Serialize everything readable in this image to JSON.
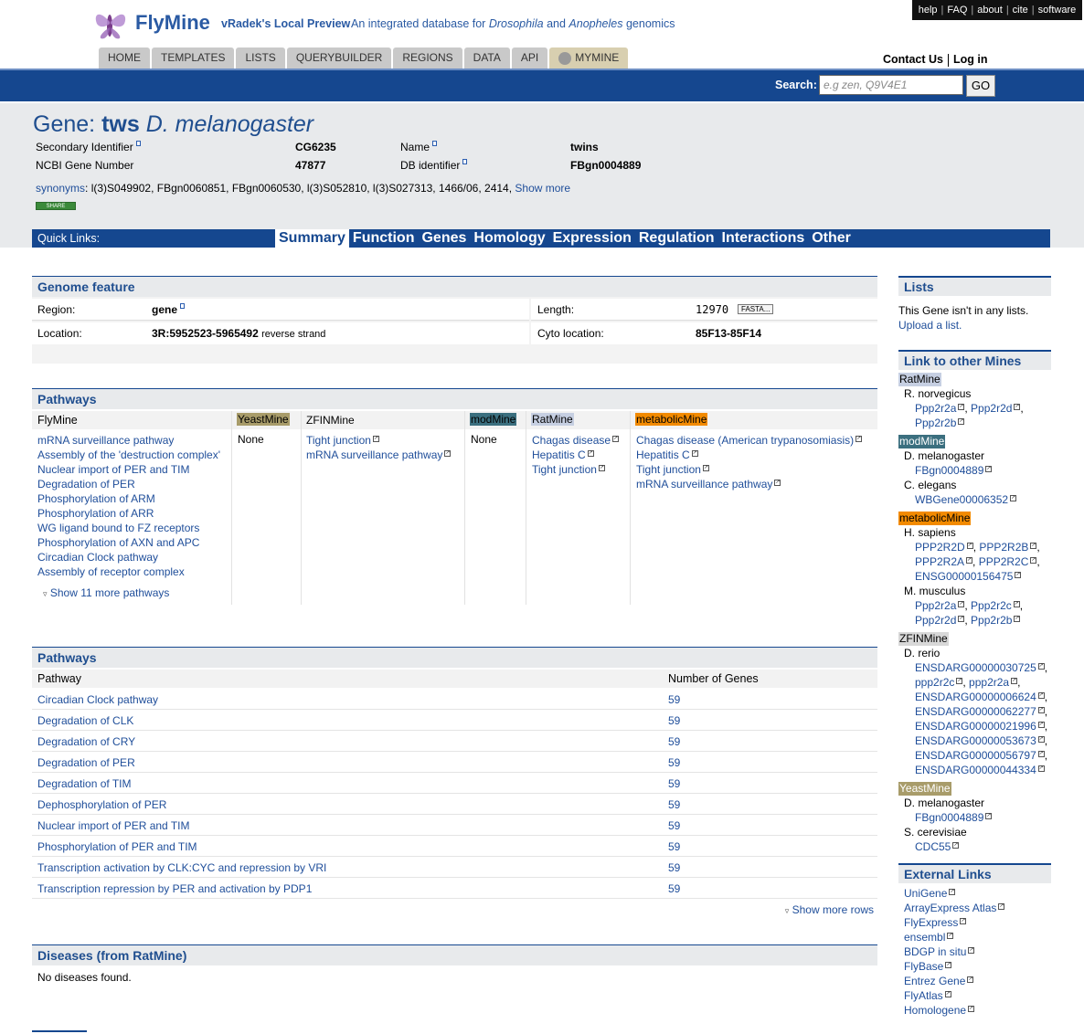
{
  "header": {
    "brand": "FlyMine",
    "preview": "vRadek's Local Preview",
    "tagline_pre": "An integrated database for",
    "tagline_dros": "Drosophila",
    "tagline_and": "and",
    "tagline_anoph": "Anopheles",
    "tagline_post": "genomics",
    "toplinks": [
      "help",
      "FAQ",
      "about",
      "cite",
      "software"
    ],
    "tabs": [
      "HOME",
      "TEMPLATES",
      "LISTS",
      "QUERYBUILDER",
      "REGIONS",
      "DATA",
      "API",
      "MYMINE"
    ],
    "contact": "Contact Us",
    "login": "Log in",
    "search_label": "Search:",
    "search_placeholder": "e.g zen, Q9V4E1",
    "go": "GO"
  },
  "gene": {
    "title_prefix": "Gene:",
    "symbol": "tws",
    "organism": "D. melanogaster",
    "fields": [
      {
        "label": "Secondary Identifier",
        "value": "CG6235"
      },
      {
        "label": "NCBI Gene Number",
        "value": "47877"
      },
      {
        "label": "Name",
        "value": "twins"
      },
      {
        "label": "DB identifier",
        "value": "FBgn0004889"
      }
    ],
    "synonyms_label": "synonyms",
    "synonyms": ": l(3)S049902, FBgn0060851, FBgn0060530, l(3)S052810, l(3)S027313, 1466/06, 2414,",
    "show_more": "Show more",
    "share": "SHARE"
  },
  "quicklinks": {
    "label": "Quick Links:",
    "items": [
      "Summary",
      "Function",
      "Genes",
      "Homology",
      "Expression",
      "Regulation",
      "Interactions",
      "Other"
    ]
  },
  "genome_feature": {
    "title": "Genome feature",
    "region_label": "Region:",
    "region_value": "gene",
    "length_label": "Length:",
    "length_value": "12970",
    "fasta": "FASTA...",
    "location_label": "Location:",
    "location_value": "3R:5952523-5965492",
    "location_strand": "reverse strand",
    "cyto_label": "Cyto location:",
    "cyto_value": "85F13-85F14"
  },
  "pathways_mines": {
    "title": "Pathways",
    "flymine_label": "FlyMine",
    "flymine": [
      "mRNA surveillance pathway",
      "Assembly of the 'destruction complex'",
      "Nuclear import of PER and TIM",
      "Degradation of PER",
      "Phosphorylation of ARM",
      "Phosphorylation of ARR",
      "WG ligand bound to FZ receptors",
      "Phosphorylation of AXN and APC",
      "Circadian Clock pathway",
      "Assembly of receptor complex"
    ],
    "show_more": "Show 11 more pathways",
    "yeast_label": "YeastMine",
    "yeast_none": "None",
    "zfin_label": "ZFINMine",
    "zfin": [
      "Tight junction",
      "mRNA surveillance pathway"
    ],
    "mod_label": "modMine",
    "mod_none": "None",
    "rat_label": "RatMine",
    "rat": [
      "Chagas disease",
      "Hepatitis C",
      "Tight junction"
    ],
    "metabolic_label": "metabolicMine",
    "metabolic": [
      "Chagas disease (American trypanosomiasis)",
      "Hepatitis C",
      "Tight junction",
      "mRNA surveillance pathway"
    ]
  },
  "pathways_table": {
    "title": "Pathways",
    "col_pathway": "Pathway",
    "col_genes": "Number of Genes",
    "rows": [
      {
        "name": "Circadian Clock pathway",
        "genes": "59"
      },
      {
        "name": "Degradation of CLK",
        "genes": "59"
      },
      {
        "name": "Degradation of CRY",
        "genes": "59"
      },
      {
        "name": "Degradation of PER",
        "genes": "59"
      },
      {
        "name": "Degradation of TIM",
        "genes": "59"
      },
      {
        "name": "Dephosphorylation of PER",
        "genes": "59"
      },
      {
        "name": "Nuclear import of PER and TIM",
        "genes": "59"
      },
      {
        "name": "Phosphorylation of PER and TIM",
        "genes": "59"
      },
      {
        "name": "Transcription activation by CLK:CYC and repression by VRI",
        "genes": "59"
      },
      {
        "name": "Transcription repression by PER and activation by PDP1",
        "genes": "59"
      }
    ],
    "show_more": "Show more rows"
  },
  "diseases": {
    "title": "Diseases (from RatMine)",
    "empty": "No diseases found."
  },
  "sidebar": {
    "lists_title": "Lists",
    "lists_text": "This Gene isn't in any lists.",
    "upload": "Upload a list.",
    "links_title": "Link to other Mines",
    "ratmine": "RatMine",
    "rat_org": "R. norvegicus",
    "rat_genes": [
      "Ppp2r2a",
      "Ppp2r2d",
      "Ppp2r2b"
    ],
    "modmine": "modMine",
    "mod_org1": "D. melanogaster",
    "mod_gene1": "FBgn0004889",
    "mod_org2": "C. elegans",
    "mod_gene2": "WBGene00006352",
    "metabolicmine": "metabolicMine",
    "met_org1": "H. sapiens",
    "met_genes1": [
      "PPP2R2D",
      "PPP2R2B",
      "PPP2R2A",
      "PPP2R2C",
      "ENSG00000156475"
    ],
    "met_org2": "M. musculus",
    "met_genes2": [
      "Ppp2r2a",
      "Ppp2r2c",
      "Ppp2r2d",
      "Ppp2r2b"
    ],
    "zfinmine": "ZFINMine",
    "zfin_org": "D. rerio",
    "zfin_genes": [
      "ENSDARG00000030725",
      "ppp2r2c",
      "ppp2r2a",
      "ENSDARG00000006624",
      "ENSDARG00000062277",
      "ENSDARG00000021996",
      "ENSDARG00000053673",
      "ENSDARG00000056797",
      "ENSDARG00000044334"
    ],
    "yeastmine": "YeastMine",
    "yeast_org1": "D. melanogaster",
    "yeast_gene1": "FBgn0004889",
    "yeast_org2": "S. cerevisiae",
    "yeast_gene2": "CDC55",
    "external_title": "External Links",
    "external": [
      "UniGene",
      "ArrayExpress Atlas",
      "FlyExpress",
      "ensembl",
      "BDGP in situ",
      "FlyBase",
      "Entrez Gene",
      "FlyAtlas",
      "Homologene"
    ]
  },
  "colors": {
    "blue": "#15478f",
    "yeast": "#a89c6a",
    "mod": "#3b6f7f",
    "rat": "#c6cfe2",
    "metabolic": "#f28a00",
    "zfin": "#d8d8d8"
  }
}
